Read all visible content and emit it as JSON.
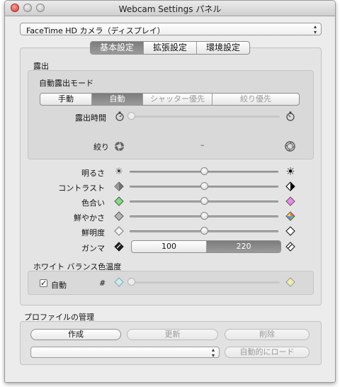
{
  "window": {
    "title": "Webcam Settings パネル"
  },
  "device": {
    "selected": "FaceTime HD カメラ（ディスプレイ）"
  },
  "tabs": [
    {
      "label": "基本設定",
      "selected": true
    },
    {
      "label": "拡張設定",
      "selected": false
    },
    {
      "label": "環境設定",
      "selected": false
    }
  ],
  "exposure": {
    "section_title": "露出",
    "mode_title": "自動露出モード",
    "modes": [
      {
        "label": "手動",
        "state": "normal"
      },
      {
        "label": "自動",
        "state": "selected"
      },
      {
        "label": "シャッター優先",
        "state": "disabled"
      },
      {
        "label": "絞り優先",
        "state": "disabled"
      }
    ],
    "time_label": "露出時間",
    "time_value": 0.0,
    "aperture_label": "絞り",
    "aperture_value": "–"
  },
  "image_controls": [
    {
      "label": "明るさ",
      "value": 0.5
    },
    {
      "label": "コントラスト",
      "value": 0.5
    },
    {
      "label": "色合い",
      "value": 0.5
    },
    {
      "label": "鮮やかさ",
      "value": 0.5
    },
    {
      "label": "鮮明度",
      "value": 0.5
    }
  ],
  "gamma": {
    "label": "ガンマ",
    "options": [
      "100",
      "220"
    ],
    "selected": "220"
  },
  "white_balance": {
    "section_title": "ホワイト バランス色温度",
    "auto_label": "自動",
    "auto_checked": true,
    "value_label": "#",
    "value": 0.0
  },
  "profile": {
    "section_title": "プロファイルの管理",
    "create_label": "作成",
    "update_label": "更新",
    "delete_label": "削除",
    "popup_value": "",
    "autoload_label": "自動的にロード"
  }
}
